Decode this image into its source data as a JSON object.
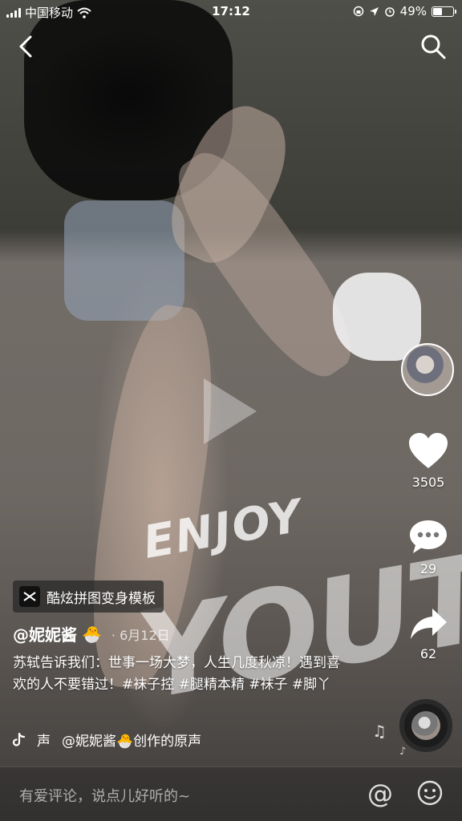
{
  "status_bar": {
    "carrier": "中国移动",
    "time": "17:12",
    "battery": "49%",
    "battery_level": 0.49
  },
  "video": {
    "overlay_text_1": "ENJOY",
    "overlay_text_2": "YOUTH!"
  },
  "right_rail": {
    "likes": "3505",
    "comments": "29",
    "shares": "62"
  },
  "template_tag": {
    "label": "酷炫拼图变身模板"
  },
  "post": {
    "author": "@妮妮酱",
    "author_emoji": "🐣",
    "date": "· 6月12日",
    "caption": "苏轼告诉我们：世事一场大梦，人生几度秋凉！遇到喜欢的人不要错过！#袜子控 #腿精本精 #袜子 #脚丫"
  },
  "music": {
    "sound_label": "声",
    "track": "@妮妮酱🐣创作的原声"
  },
  "comment_bar": {
    "placeholder": "有爱评论，说点儿好听的~",
    "at_symbol": "@"
  },
  "icons": [
    "back-icon",
    "search-icon",
    "play-icon",
    "heart-icon",
    "comment-icon",
    "share-icon",
    "music-note-icon",
    "emoji-icon",
    "tiktok-icon",
    "capcut-icon"
  ]
}
